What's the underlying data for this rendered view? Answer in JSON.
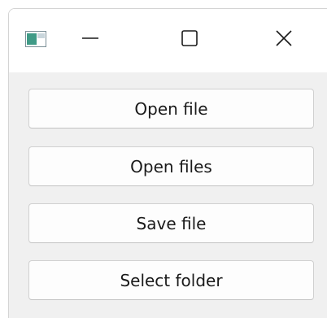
{
  "window": {
    "controls": {
      "minimize_icon": "minimize-icon",
      "maximize_icon": "maximize-icon",
      "close_icon": "close-icon"
    }
  },
  "buttons": {
    "open_file": "Open file",
    "open_files": "Open files",
    "save_file": "Save file",
    "select_folder": "Select folder"
  },
  "colors": {
    "titlebar": "#ffffff",
    "client_area": "#f0f0f0",
    "button_face": "#fdfdfd",
    "button_border": "#d0d0d0",
    "icon_teal": "#3f9a86"
  }
}
